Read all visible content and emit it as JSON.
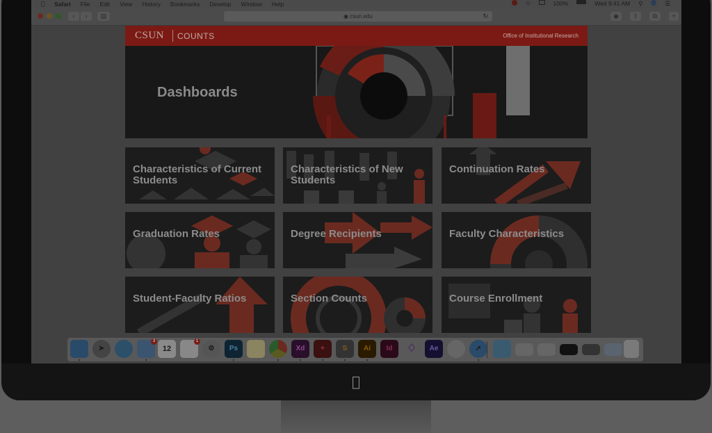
{
  "menubar": {
    "apple": "",
    "app": "Safari",
    "items": [
      "File",
      "Edit",
      "View",
      "History",
      "Bookmarks",
      "Develop",
      "Window",
      "Help"
    ],
    "battery": "100%",
    "clock": "Wed 9:41 AM"
  },
  "browser": {
    "url": "csun.edu"
  },
  "site": {
    "logo": "CSUN",
    "logo_sub": "COUNTS",
    "office": "Office of Institutional Research",
    "hero_title": "Dashboards",
    "tiles": [
      {
        "label": "Characteristics of Current Students"
      },
      {
        "label": "Characteristics of New Students"
      },
      {
        "label": "Continuation Rates"
      },
      {
        "label": "Graduation Rates"
      },
      {
        "label": "Degree Recipients"
      },
      {
        "label": "Faculty Characteristics"
      },
      {
        "label": "Student-Faculty Ratios"
      },
      {
        "label": "Section Counts"
      },
      {
        "label": "Course Enrollment"
      }
    ]
  },
  "dock": {
    "calendar_day": "12",
    "mail_badge": "3",
    "reminders_badge": "1",
    "apps": [
      "Finder",
      "Launchpad",
      "Messages",
      "Mail",
      "Calendar",
      "Reminders",
      "System Preferences",
      "Photoshop",
      "Notes",
      "Chrome",
      "Adobe XD",
      "Acrobat",
      "Sublime Text",
      "Illustrator",
      "InDesign",
      "GitHub",
      "After Effects",
      "Sequel Pro",
      "Safari"
    ],
    "app_labels": {
      "ps": "Ps",
      "xd": "Xd",
      "ai": "Ai",
      "id": "Id",
      "ae": "Ae"
    }
  },
  "colors": {
    "brand_red": "#7b1a14",
    "tile_accent": "#6b2a20"
  }
}
